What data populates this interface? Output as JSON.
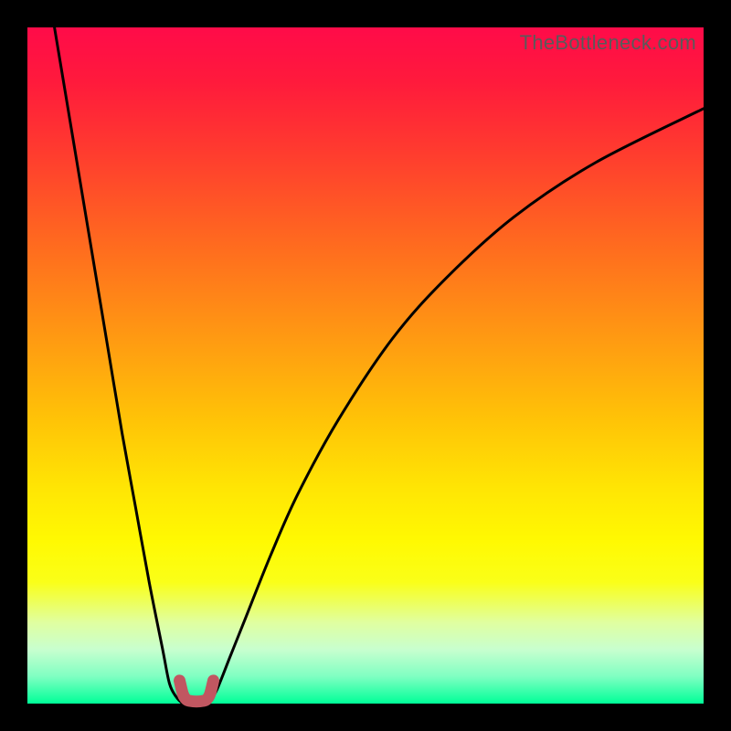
{
  "watermark": "TheBottleneck.com",
  "chart_data": {
    "type": "line",
    "title": "",
    "xlabel": "",
    "ylabel": "",
    "xlim": [
      0,
      100
    ],
    "ylim": [
      0,
      100
    ],
    "series": [
      {
        "name": "left-curve",
        "x": [
          4,
          6,
          8,
          10,
          12,
          14,
          16,
          18,
          20,
          21,
          22,
          23,
          23.5
        ],
        "y": [
          100,
          88,
          76,
          64,
          52,
          40,
          29,
          18,
          8,
          3,
          1,
          0,
          0
        ]
      },
      {
        "name": "right-curve",
        "x": [
          26.5,
          27,
          28,
          30,
          32,
          36,
          40,
          46,
          54,
          62,
          72,
          84,
          100
        ],
        "y": [
          0,
          0.5,
          2,
          7,
          12,
          22,
          31,
          42,
          54,
          63,
          72,
          80,
          88
        ]
      },
      {
        "name": "bottom-accent",
        "x": [
          22.5,
          23,
          23.5,
          24,
          25,
          26,
          26.5,
          27,
          27.5
        ],
        "y": [
          3.4,
          1.4,
          0.6,
          0.4,
          0.3,
          0.4,
          0.6,
          1.4,
          3.4
        ]
      }
    ],
    "accent_color": "#c15761",
    "curve_color": "#000000"
  }
}
